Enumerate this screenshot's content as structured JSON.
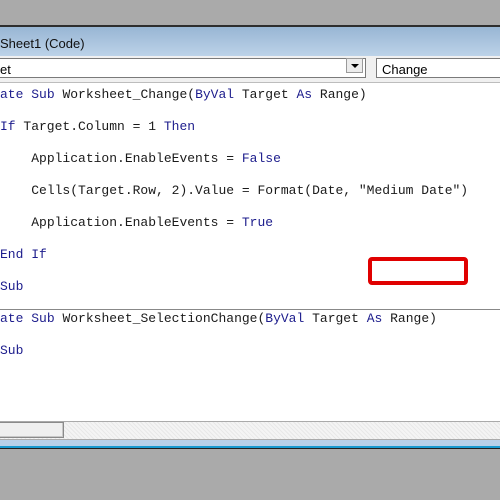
{
  "window": {
    "title": "Sheet1 (Code)"
  },
  "toolbar": {
    "object_combo_value": "et",
    "procedure_combo_value": "Change"
  },
  "code": {
    "lines": [
      {
        "indent": "",
        "parts": [
          {
            "t": "ate ",
            "k": true
          },
          {
            "t": "Sub ",
            "k": true
          },
          {
            "t": "Worksheet_Change(",
            "k": false
          },
          {
            "t": "ByVal ",
            "k": true
          },
          {
            "t": "Target ",
            "k": false
          },
          {
            "t": "As ",
            "k": true
          },
          {
            "t": "Range)",
            "k": false
          }
        ]
      },
      {
        "indent": "",
        "parts": [
          {
            "t": "If ",
            "k": true
          },
          {
            "t": "Target.Column = 1 ",
            "k": false
          },
          {
            "t": "Then",
            "k": true
          }
        ]
      },
      {
        "indent": "    ",
        "parts": [
          {
            "t": "Application.EnableEvents = ",
            "k": false
          },
          {
            "t": "False",
            "k": true
          }
        ]
      },
      {
        "indent": "    ",
        "parts": [
          {
            "t": "Cells(Target.Row, 2).Value = Format(Date, ",
            "k": false
          },
          {
            "t": "\"Medium Date\"",
            "k": false
          },
          {
            "t": ")",
            "k": false
          }
        ]
      },
      {
        "indent": "    ",
        "parts": [
          {
            "t": "Application.EnableEvents = ",
            "k": false
          },
          {
            "t": "True",
            "k": true
          }
        ]
      },
      {
        "indent": "",
        "parts": [
          {
            "t": "End If",
            "k": true
          }
        ]
      },
      {
        "indent": "",
        "parts": [
          {
            "t": "Sub",
            "k": true
          }
        ]
      },
      {
        "indent": "",
        "parts": [
          {
            "t": "ate ",
            "k": true
          },
          {
            "t": "Sub ",
            "k": true
          },
          {
            "t": "Worksheet_SelectionChange(",
            "k": false
          },
          {
            "t": "ByVal ",
            "k": true
          },
          {
            "t": "Target ",
            "k": false
          },
          {
            "t": "As ",
            "k": true
          },
          {
            "t": "Range)",
            "k": false
          }
        ]
      },
      {
        "indent": "",
        "parts": [
          {
            "t": "Sub",
            "k": true
          }
        ]
      }
    ],
    "highlighted_text": "\"Medium Date\""
  },
  "colors": {
    "keyword": "#1c1c8c",
    "highlight_box": "#e00000",
    "titlebar": "#a8c2dc"
  }
}
